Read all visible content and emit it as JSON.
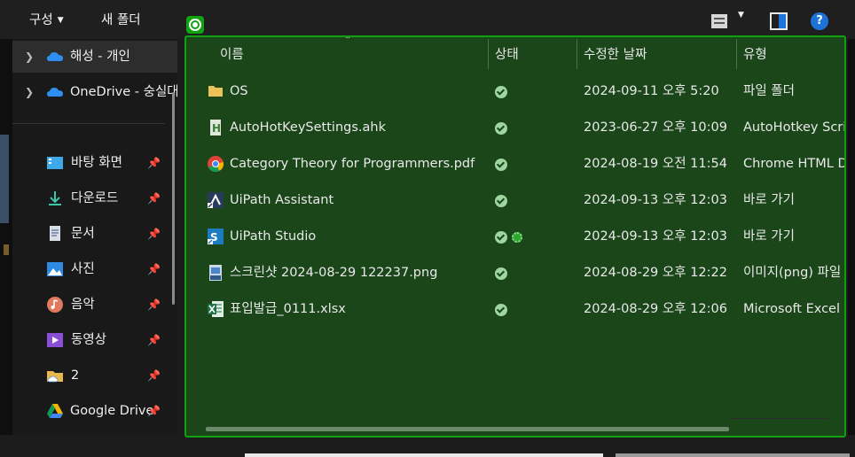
{
  "toolbar": {
    "organize_label": "구성",
    "new_folder_label": "새 폴더",
    "view_icon": "view-details-icon",
    "preview_icon": "preview-pane-icon",
    "help_icon": "help-icon",
    "help_glyph": "?"
  },
  "nav": {
    "items": [
      {
        "label": "해성 - 개인",
        "icon": "onedrive-cloud-icon",
        "expandable": true
      },
      {
        "label": "OneDrive - 숭실대학교",
        "icon": "onedrive-cloud-icon",
        "expandable": true
      },
      {
        "label": "바탕 화면",
        "icon": "desktop-icon",
        "pinned": true
      },
      {
        "label": "다운로드",
        "icon": "download-icon",
        "pinned": true
      },
      {
        "label": "문서",
        "icon": "document-icon",
        "pinned": true
      },
      {
        "label": "사진",
        "icon": "pictures-icon",
        "pinned": true
      },
      {
        "label": "음악",
        "icon": "music-icon",
        "pinned": true
      },
      {
        "label": "동영상",
        "icon": "video-icon",
        "pinned": true
      },
      {
        "label": "2",
        "icon": "cloud-folder-icon",
        "pinned": true
      },
      {
        "label": "Google Drive",
        "icon": "google-drive-icon",
        "pinned": true
      }
    ]
  },
  "list": {
    "columns": {
      "name": "이름",
      "status": "상태",
      "modified": "수정한 날짜",
      "type": "유형"
    },
    "rows": [
      {
        "name": "OS",
        "modified": "2024-09-11 오후 5:20",
        "type": "파일 폴더",
        "icon": "folder-icon"
      },
      {
        "name": "AutoHotKeySettings.ahk",
        "modified": "2023-06-27 오후 10:09",
        "type": "AutoHotkey Script",
        "icon": "ahk-file-icon"
      },
      {
        "name": "Category Theory for Programmers.pdf",
        "modified": "2024-08-19 오전 11:54",
        "type": "Chrome HTML Document",
        "icon": "chrome-icon"
      },
      {
        "name": "UiPath Assistant",
        "modified": "2024-09-13 오후 12:03",
        "type": "바로 가기",
        "icon": "uipath-assistant-icon"
      },
      {
        "name": "UiPath Studio",
        "modified": "2024-09-13 오후 12:03",
        "type": "바로 가기",
        "icon": "uipath-studio-icon"
      },
      {
        "name": "스크린샷 2024-08-29 122237.png",
        "modified": "2024-08-29 오후 12:22",
        "type": "이미지(png) 파일",
        "icon": "png-file-icon"
      },
      {
        "name": "표입발급_0111.xlsx",
        "modified": "2024-08-29 오후 12:06",
        "type": "Microsoft Excel 워크시트",
        "icon": "excel-file-icon"
      }
    ]
  },
  "colors": {
    "overlay_bg": "#1a461a",
    "overlay_border": "#0fa10f",
    "accent": "#1e73d8"
  }
}
